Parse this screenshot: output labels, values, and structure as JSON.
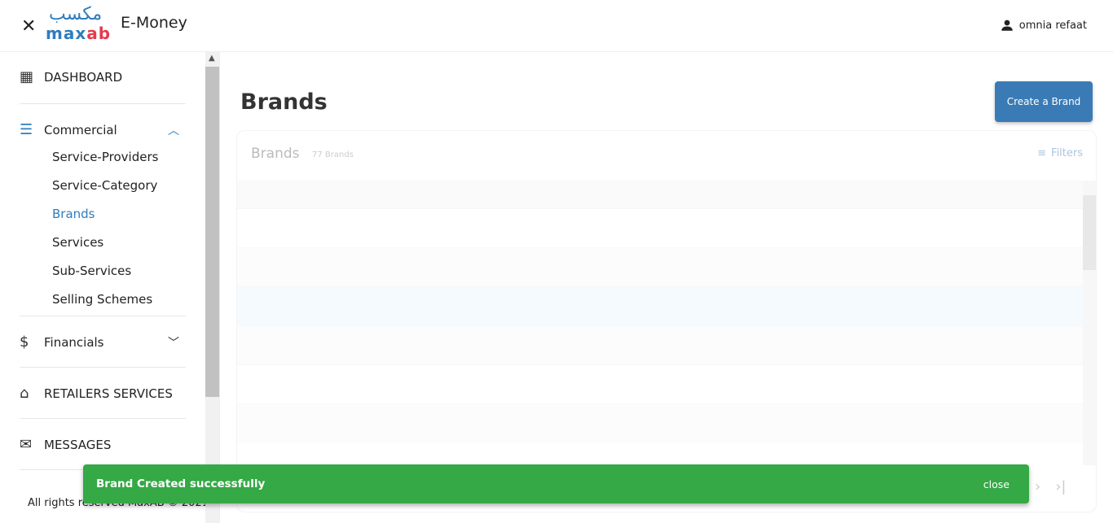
{
  "header": {
    "app_title": "E-Money",
    "logo_ar": "مكسب",
    "logo_en_a": "max",
    "logo_en_b": "ab",
    "user_name": "omnia refaat"
  },
  "sidebar": {
    "dashboard": "DASHBOARD",
    "commercial": "Commercial",
    "commercial_items": [
      "Service-Providers",
      "Service-Category",
      "Brands",
      "Services",
      "Sub-Services",
      "Selling Schemes"
    ],
    "financials": "Financials",
    "retailers": "RETAILERS SERVICES",
    "messages": "MESSAGES",
    "footer": "All rights reserved MaxAB © 2021"
  },
  "main": {
    "title": "Brands",
    "create_label": "Create a Brand",
    "card_title": "Brands",
    "count": "77 Brands",
    "filters": "Filters"
  },
  "snackbar": {
    "message": "Brand Created successfully",
    "close": "close",
    "color": "#34a946"
  }
}
